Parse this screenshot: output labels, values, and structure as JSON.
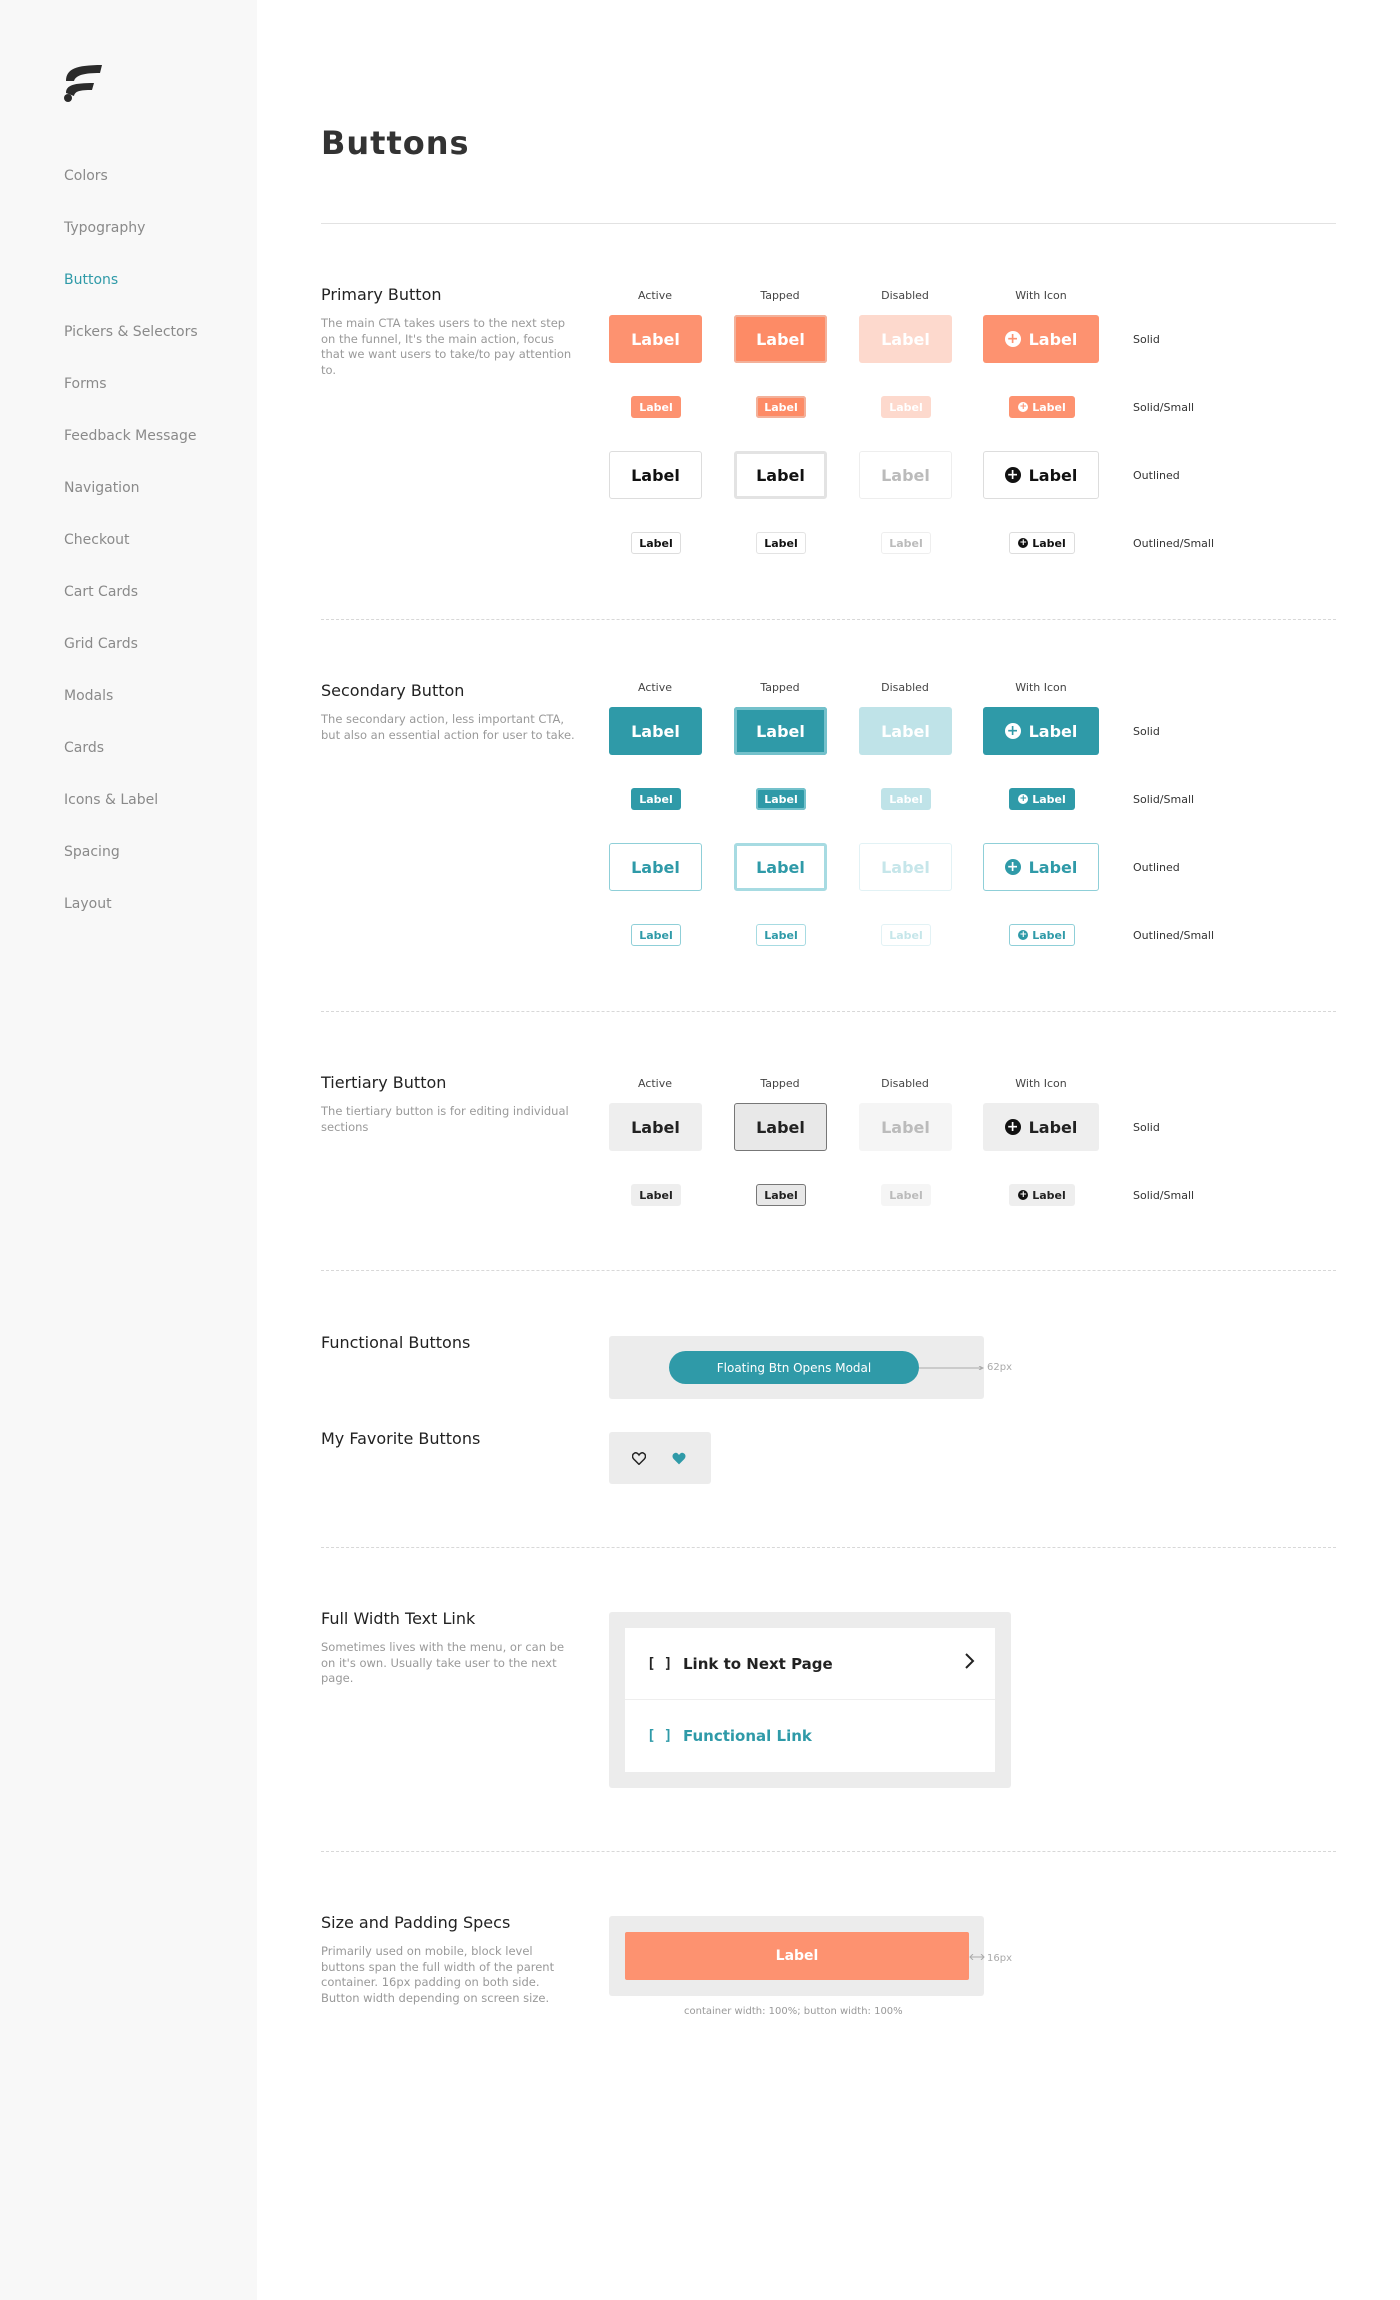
{
  "sidebar": {
    "items": [
      {
        "label": "Colors"
      },
      {
        "label": "Typography"
      },
      {
        "label": "Buttons"
      },
      {
        "label": "Pickers & Selectors"
      },
      {
        "label": "Forms"
      },
      {
        "label": "Feedback Message"
      },
      {
        "label": "Navigation"
      },
      {
        "label": "Checkout"
      },
      {
        "label": "Cart Cards"
      },
      {
        "label": "Grid Cards"
      },
      {
        "label": "Modals"
      },
      {
        "label": "Cards"
      },
      {
        "label": "Icons & Label"
      },
      {
        "label": "Spacing"
      },
      {
        "label": "Layout"
      }
    ],
    "active_item": "Buttons"
  },
  "page": {
    "title": "Buttons"
  },
  "columns": {
    "active": "Active",
    "tapped": "Tapped",
    "disabled": "Disabled",
    "with_icon": "With Icon"
  },
  "button_label": "Label",
  "rows": {
    "solid": "Solid",
    "solid_small": "Solid/Small",
    "outlined": "Outlined",
    "outlined_small": "Outlined/Small"
  },
  "primary": {
    "title": "Primary Button",
    "description": "The main CTA takes users to the next step on the funnel, It's the main action, focus that we want users to take/to pay attention to."
  },
  "secondary": {
    "title": "Secondary Button",
    "description": "The secondary action, less important CTA, but also an essential action for user to take."
  },
  "tertiary": {
    "title": "Tiertiary Button",
    "description": "The tiertiary button is for editing individual sections"
  },
  "functional": {
    "title": "Functional Buttons",
    "floating_label": "Floating Btn Opens Modal",
    "spec": "62px"
  },
  "favorite": {
    "title": "My Favorite Buttons"
  },
  "text_link": {
    "title": "Full Width Text Link",
    "description": "Sometimes lives with the menu, or can be on it's own. Usually take user to the next page.",
    "link_next": "Link to Next Page",
    "link_functional": "Functional Link",
    "bracket_icon": "[ ]"
  },
  "size_specs": {
    "title": "Size and Padding Specs",
    "description": "Primarily used on mobile, block level buttons span the full width of the parent container. 16px padding on both side. Button width depending on screen size.",
    "button_label": "Label",
    "spec": "16px",
    "caption": "container width: 100%; button width: 100%"
  },
  "colors": {
    "primary": "#fd9270",
    "secondary": "#2f9aa8",
    "tertiary": "#eeeeee"
  },
  "icons": [
    "logo-icon",
    "plus-circle-icon",
    "heart-outline-icon",
    "heart-filled-icon",
    "bracket-icon",
    "chevron-right-icon"
  ]
}
